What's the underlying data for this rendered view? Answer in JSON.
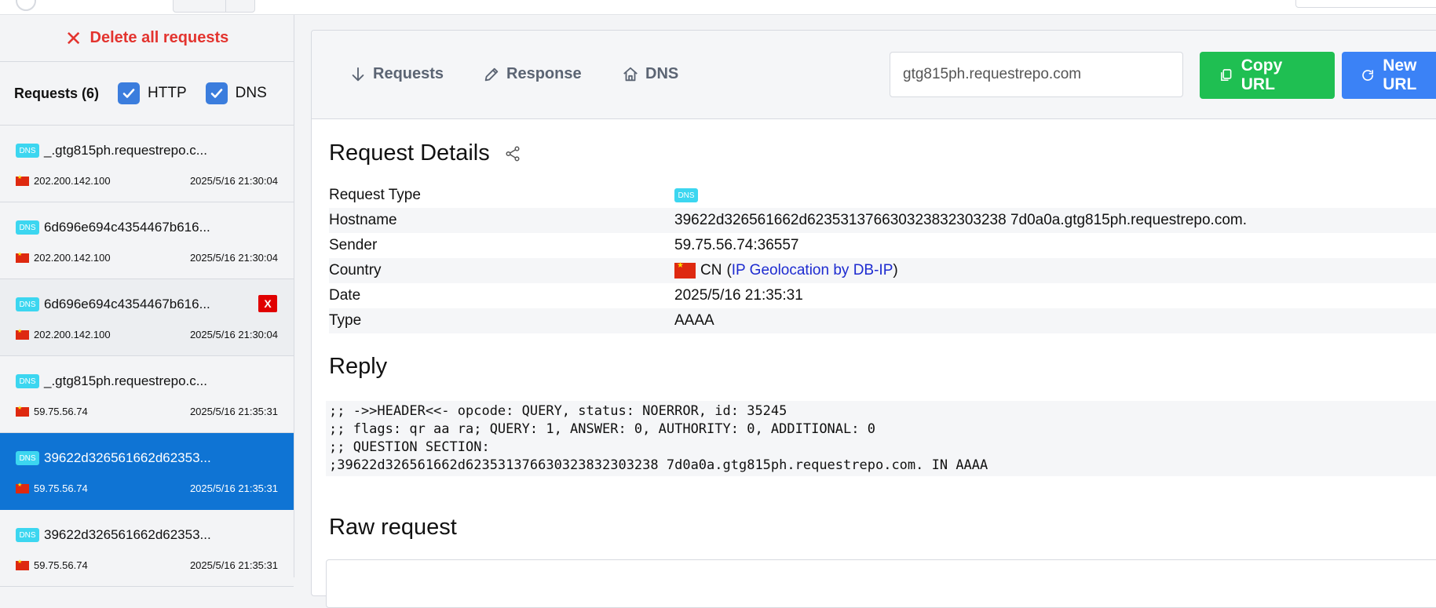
{
  "sidebar": {
    "delete_all_label": "Delete all requests",
    "requests_title": "Requests (6)",
    "filters": [
      {
        "label": "HTTP",
        "checked": true
      },
      {
        "label": "DNS",
        "checked": true
      }
    ],
    "items": [
      {
        "type": "DNS",
        "name": "_.gtg815ph.requestrepo.c...",
        "ip": "202.200.142.100",
        "date": "2025/5/16 21:30:04"
      },
      {
        "type": "DNS",
        "name": "6d696e694c4354467b616...",
        "ip": "202.200.142.100",
        "date": "2025/5/16 21:30:04"
      },
      {
        "type": "DNS",
        "name": "6d696e694c4354467b616...",
        "ip": "202.200.142.100",
        "date": "2025/5/16 21:30:04",
        "delete_label": "X"
      },
      {
        "type": "DNS",
        "name": "_.gtg815ph.requestrepo.c...",
        "ip": "59.75.56.74",
        "date": "2025/5/16 21:35:31"
      },
      {
        "type": "DNS",
        "name": "39622d326561662d62353...",
        "ip": "59.75.56.74",
        "date": "2025/5/16 21:35:31",
        "active": true
      },
      {
        "type": "DNS",
        "name": "39622d326561662d62353...",
        "ip": "59.75.56.74",
        "date": "2025/5/16 21:35:31"
      }
    ]
  },
  "nav": {
    "tabs": [
      {
        "label": "Requests",
        "icon": "arrow-down-icon"
      },
      {
        "label": "Response",
        "icon": "pencil-icon"
      },
      {
        "label": "DNS",
        "icon": "home-icon"
      }
    ],
    "url_value": "gtg815ph.requestrepo.com",
    "copy_label": "Copy URL",
    "new_label": "New URL"
  },
  "details": {
    "title": "Request Details",
    "rows": [
      {
        "key": "Request Type",
        "value": "DNS"
      },
      {
        "key": "Hostname",
        "value": "39622d326561662d623531376630323832303238 7d0a0a.gtg815ph.requestrepo.com."
      },
      {
        "key": "Sender",
        "value": "59.75.56.74:36557"
      },
      {
        "key": "Country",
        "value": "CN",
        "link": "IP Geolocation by DB-IP"
      },
      {
        "key": "Date",
        "value": "2025/5/16 21:35:31"
      },
      {
        "key": "Type",
        "value": "AAAA"
      }
    ]
  },
  "reply": {
    "title": "Reply",
    "lines": [
      ";; ->>HEADER<<- opcode: QUERY, status: NOERROR, id: 35245",
      ";; flags: qr aa ra; QUERY: 1, ANSWER: 0, AUTHORITY: 0, ADDITIONAL: 0",
      ";; QUESTION SECTION:",
      ";39622d326561662d623531376630323832303238 7d0a0a.gtg815ph.requestrepo.com. IN AAAA"
    ]
  },
  "raw": {
    "title": "Raw request"
  },
  "colors": {
    "delete": "#e3342f",
    "active_row": "#0f74d4",
    "dns_badge": "#3cd6f0",
    "copy_btn": "#1fbf52",
    "new_btn": "#3b82f6",
    "link": "#1d2bd0"
  }
}
